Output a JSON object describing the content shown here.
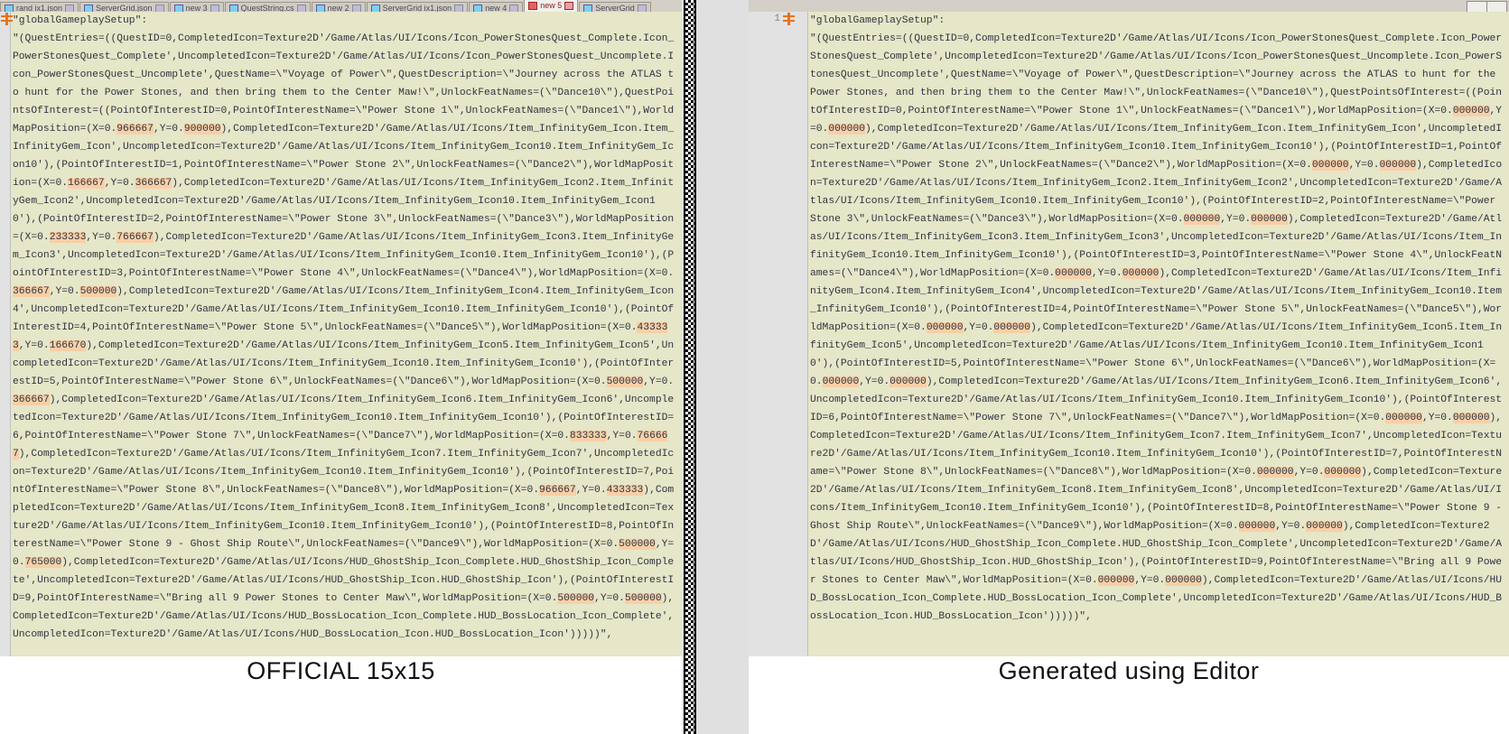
{
  "window": {
    "tabs": [
      {
        "label": "rand ix1.json",
        "active": false
      },
      {
        "label": "ServerGrid.json",
        "active": false
      },
      {
        "label": "new 3",
        "active": false
      },
      {
        "label": "QuestString.cs",
        "active": false
      },
      {
        "label": "new 2",
        "active": false
      },
      {
        "label": "ServerGrid ix1.json",
        "active": false
      },
      {
        "label": "new 4",
        "active": false
      },
      {
        "label": "new 5",
        "active": true
      },
      {
        "label": "ServerGrid",
        "active": false
      }
    ],
    "tab_controls": [
      "minimize-restore",
      "close"
    ]
  },
  "panes": {
    "left": {
      "caption": "OFFICIAL 15x15",
      "line_number": "",
      "fold_marker": "fold-marker-icon",
      "lines": [
        {
          "text": "\"globalGameplaySetup\":"
        },
        {
          "text": "\"(QuestEntries=((QuestID=0,CompletedIcon=Texture2D'/Game/Atlas/UI/Icons/Icon_PowerStonesQuest_Complete.Icon_PowerStonesQuest_Complete',UncompletedIcon=Texture2D'/Game/Atlas/UI/Icons/Icon_PowerStonesQuest_Uncomplete.Icon_PowerStonesQuest_Uncomplete',QuestName=\\\"Voyage of Power\\\",QuestDescription=\\\"Journey across the ATLAS to hunt for the Power Stones, and then bring them to the Center Maw!\\\",UnlockFeatNames=(\\\"Dance10\\\"),QuestPointsOfInterest=((PointOfInterestID=0,PointOfInterestName=\\\"Power Stone 1\\\",UnlockFeatNames=(\\\"Dance1\\\"),WorldMapPosition=(X=0."
        },
        {
          "hl": "966667"
        },
        {
          "text": ",Y=0."
        },
        {
          "hl": "900000"
        },
        {
          "text": "),CompletedIcon=Texture2D'/Game/Atlas/UI/Icons/Item_InfinityGem_Icon.Item_InfinityGem_Icon',UncompletedIcon=Texture2D'/Game/Atlas/UI/Icons/Item_InfinityGem_Icon10.Item_InfinityGem_Icon10'),(PointOfInterestID=1,PointOfInterestName=\\\"Power Stone 2\\\",UnlockFeatNames=(\\\"Dance2\\\"),WorldMapPosition=(X=0."
        },
        {
          "hl": "166667"
        },
        {
          "text": ",Y=0."
        },
        {
          "hl": "366667"
        },
        {
          "text": "),CompletedIcon=Texture2D'/Game/Atlas/UI/Icons/Item_InfinityGem_Icon2.Item_InfinityGem_Icon2',UncompletedIcon=Texture2D'/Game/Atlas/UI/Icons/Item_InfinityGem_Icon10.Item_InfinityGem_Icon10'),(PointOfInterestID=2,PointOfInterestName=\\\"Power Stone 3\\\",UnlockFeatNames=(\\\"Dance3\\\"),WorldMapPosition=(X=0."
        },
        {
          "hl": "233333"
        },
        {
          "text": ",Y=0."
        },
        {
          "hl": "766667"
        },
        {
          "text": "),CompletedIcon=Texture2D'/Game/Atlas/UI/Icons/Item_InfinityGem_Icon3.Item_InfinityGem_Icon3',UncompletedIcon=Texture2D'/Game/Atlas/UI/Icons/Item_InfinityGem_Icon10.Item_InfinityGem_Icon10'),(PointOfInterestID=3,PointOfInterestName=\\\"Power Stone 4\\\",UnlockFeatNames=(\\\"Dance4\\\"),WorldMapPosition=(X=0."
        },
        {
          "hl": "366667"
        },
        {
          "text": ",Y=0."
        },
        {
          "hl": "500000"
        },
        {
          "text": "),CompletedIcon=Texture2D'/Game/Atlas/UI/Icons/Item_InfinityGem_Icon4.Item_InfinityGem_Icon4',UncompletedIcon=Texture2D'/Game/Atlas/UI/Icons/Item_InfinityGem_Icon10.Item_InfinityGem_Icon10'),(PointOfInterestID=4,PointOfInterestName=\\\"Power Stone 5\\\",UnlockFeatNames=(\\\"Dance5\\\"),WorldMapPosition=(X=0."
        },
        {
          "hl": "433333"
        },
        {
          "text": ",Y=0."
        },
        {
          "hl": "166670"
        },
        {
          "text": "),CompletedIcon=Texture2D'/Game/Atlas/UI/Icons/Item_InfinityGem_Icon5.Item_InfinityGem_Icon5',UncompletedIcon=Texture2D'/Game/Atlas/UI/Icons/Item_InfinityGem_Icon10.Item_InfinityGem_Icon10'),(PointOfInterestID=5,PointOfInterestName=\\\"Power Stone 6\\\",UnlockFeatNames=(\\\"Dance6\\\"),WorldMapPosition=(X=0."
        },
        {
          "hl": "500000"
        },
        {
          "text": ",Y=0."
        },
        {
          "hl": "366667"
        },
        {
          "text": "),CompletedIcon=Texture2D'/Game/Atlas/UI/Icons/Item_InfinityGem_Icon6.Item_InfinityGem_Icon6',UncompletedIcon=Texture2D'/Game/Atlas/UI/Icons/Item_InfinityGem_Icon10.Item_InfinityGem_Icon10'),(PointOfInterestID=6,PointOfInterestName=\\\"Power Stone 7\\\",UnlockFeatNames=(\\\"Dance7\\\"),WorldMapPosition=(X=0."
        },
        {
          "hl": "833333"
        },
        {
          "text": ",Y=0."
        },
        {
          "hl": "766667"
        },
        {
          "text": "),CompletedIcon=Texture2D'/Game/Atlas/UI/Icons/Item_InfinityGem_Icon7.Item_InfinityGem_Icon7',UncompletedIcon=Texture2D'/Game/Atlas/UI/Icons/Item_InfinityGem_Icon10.Item_InfinityGem_Icon10'),(PointOfInterestID=7,PointOfInterestName=\\\"Power Stone 8\\\",UnlockFeatNames=(\\\"Dance8\\\"),WorldMapPosition=(X=0."
        },
        {
          "hl": "966667"
        },
        {
          "text": ",Y=0."
        },
        {
          "hl": "433333"
        },
        {
          "text": "),CompletedIcon=Texture2D'/Game/Atlas/UI/Icons/Item_InfinityGem_Icon8.Item_InfinityGem_Icon8',UncompletedIcon=Texture2D'/Game/Atlas/UI/Icons/Item_InfinityGem_Icon10.Item_InfinityGem_Icon10'),(PointOfInterestID=8,PointOfInterestName=\\\"Power Stone 9 - Ghost Ship Route\\\",UnlockFeatNames=(\\\"Dance9\\\"),WorldMapPosition=(X=0."
        },
        {
          "hl": "500000"
        },
        {
          "text": ",Y=0."
        },
        {
          "hl": "765000"
        },
        {
          "text": "),CompletedIcon=Texture2D'/Game/Atlas/UI/Icons/HUD_GhostShip_Icon_Complete.HUD_GhostShip_Icon_Complete',UncompletedIcon=Texture2D'/Game/Atlas/UI/Icons/HUD_GhostShip_Icon.HUD_GhostShip_Icon'),(PointOfInterestID=9,PointOfInterestName=\\\"Bring all 9 Power Stones to Center Maw\\\",WorldMapPosition=(X=0."
        },
        {
          "hl": "500000"
        },
        {
          "text": ",Y=0."
        },
        {
          "hl": "500000"
        },
        {
          "text": "),CompletedIcon=Texture2D'/Game/Atlas/UI/Icons/HUD_BossLocation_Icon_Complete.HUD_BossLocation_Icon_Complete',UncompletedIcon=Texture2D'/Game/Atlas/UI/Icons/HUD_BossLocation_Icon.HUD_BossLocation_Icon')))))\","
        }
      ]
    },
    "right": {
      "caption": "Generated using Editor",
      "line_number": "1",
      "fold_marker": "fold-marker-icon",
      "lines": [
        {
          "text": "\"globalGameplaySetup\":"
        },
        {
          "text": "\"(QuestEntries=((QuestID=0,CompletedIcon=Texture2D'/Game/Atlas/UI/Icons/Icon_PowerStonesQuest_Complete.Icon_PowerStonesQuest_Complete',UncompletedIcon=Texture2D'/Game/Atlas/UI/Icons/Icon_PowerStonesQuest_Uncomplete.Icon_PowerStonesQuest_Uncomplete',QuestName=\\\"Voyage of Power\\\",QuestDescription=\\\"Journey across the ATLAS to hunt for the Power Stones, and then bring them to the Center Maw!\\\",UnlockFeatNames=(\\\"Dance10\\\"),QuestPointsOfInterest=((PointOfInterestID=0,PointOfInterestName=\\\"Power Stone 1\\\",UnlockFeatNames=(\\\"Dance1\\\"),WorldMapPosition=(X=0."
        },
        {
          "hl": "000000"
        },
        {
          "text": ",Y=0."
        },
        {
          "hl": "000000"
        },
        {
          "text": "),CompletedIcon=Texture2D'/Game/Atlas/UI/Icons/Item_InfinityGem_Icon.Item_InfinityGem_Icon',UncompletedIcon=Texture2D'/Game/Atlas/UI/Icons/Item_InfinityGem_Icon10.Item_InfinityGem_Icon10'),(PointOfInterestID=1,PointOfInterestName=\\\"Power Stone 2\\\",UnlockFeatNames=(\\\"Dance2\\\"),WorldMapPosition=(X=0."
        },
        {
          "hl": "000000"
        },
        {
          "text": ",Y=0."
        },
        {
          "hl": "000000"
        },
        {
          "text": "),CompletedIcon=Texture2D'/Game/Atlas/UI/Icons/Item_InfinityGem_Icon2.Item_InfinityGem_Icon2',UncompletedIcon=Texture2D'/Game/Atlas/UI/Icons/Item_InfinityGem_Icon10.Item_InfinityGem_Icon10'),(PointOfInterestID=2,PointOfInterestName=\\\"Power Stone 3\\\",UnlockFeatNames=(\\\"Dance3\\\"),WorldMapPosition=(X=0."
        },
        {
          "hl": "000000"
        },
        {
          "text": ",Y=0."
        },
        {
          "hl": "000000"
        },
        {
          "text": "),CompletedIcon=Texture2D'/Game/Atlas/UI/Icons/Item_InfinityGem_Icon3.Item_InfinityGem_Icon3',UncompletedIcon=Texture2D'/Game/Atlas/UI/Icons/Item_InfinityGem_Icon10.Item_InfinityGem_Icon10'),(PointOfInterestID=3,PointOfInterestName=\\\"Power Stone 4\\\",UnlockFeatNames=(\\\"Dance4\\\"),WorldMapPosition=(X=0."
        },
        {
          "hl": "000000"
        },
        {
          "text": ",Y=0."
        },
        {
          "hl": "000000"
        },
        {
          "text": "),CompletedIcon=Texture2D'/Game/Atlas/UI/Icons/Item_InfinityGem_Icon4.Item_InfinityGem_Icon4',UncompletedIcon=Texture2D'/Game/Atlas/UI/Icons/Item_InfinityGem_Icon10.Item_InfinityGem_Icon10'),(PointOfInterestID=4,PointOfInterestName=\\\"Power Stone 5\\\",UnlockFeatNames=(\\\"Dance5\\\"),WorldMapPosition=(X=0."
        },
        {
          "hl": "000000"
        },
        {
          "text": ",Y=0."
        },
        {
          "hl": "000000"
        },
        {
          "text": "),CompletedIcon=Texture2D'/Game/Atlas/UI/Icons/Item_InfinityGem_Icon5.Item_InfinityGem_Icon5',UncompletedIcon=Texture2D'/Game/Atlas/UI/Icons/Item_InfinityGem_Icon10.Item_InfinityGem_Icon10'),(PointOfInterestID=5,PointOfInterestName=\\\"Power Stone 6\\\",UnlockFeatNames=(\\\"Dance6\\\"),WorldMapPosition=(X=0."
        },
        {
          "hl": "000000"
        },
        {
          "text": ",Y=0."
        },
        {
          "hl": "000000"
        },
        {
          "text": "),CompletedIcon=Texture2D'/Game/Atlas/UI/Icons/Item_InfinityGem_Icon6.Item_InfinityGem_Icon6',UncompletedIcon=Texture2D'/Game/Atlas/UI/Icons/Item_InfinityGem_Icon10.Item_InfinityGem_Icon10'),(PointOfInterestID=6,PointOfInterestName=\\\"Power Stone 7\\\",UnlockFeatNames=(\\\"Dance7\\\"),WorldMapPosition=(X=0."
        },
        {
          "hl": "000000"
        },
        {
          "text": ",Y=0."
        },
        {
          "hl": "000000"
        },
        {
          "text": "),CompletedIcon=Texture2D'/Game/Atlas/UI/Icons/Item_InfinityGem_Icon7.Item_InfinityGem_Icon7',UncompletedIcon=Texture2D'/Game/Atlas/UI/Icons/Item_InfinityGem_Icon10.Item_InfinityGem_Icon10'),(PointOfInterestID=7,PointOfInterestName=\\\"Power Stone 8\\\",UnlockFeatNames=(\\\"Dance8\\\"),WorldMapPosition=(X=0."
        },
        {
          "hl": "000000"
        },
        {
          "text": ",Y=0."
        },
        {
          "hl": "000000"
        },
        {
          "text": "),CompletedIcon=Texture2D'/Game/Atlas/UI/Icons/Item_InfinityGem_Icon8.Item_InfinityGem_Icon8',UncompletedIcon=Texture2D'/Game/Atlas/UI/Icons/Item_InfinityGem_Icon10.Item_InfinityGem_Icon10'),(PointOfInterestID=8,PointOfInterestName=\\\"Power Stone 9 - Ghost Ship Route\\\",UnlockFeatNames=(\\\"Dance9\\\"),WorldMapPosition=(X=0."
        },
        {
          "hl": "000000"
        },
        {
          "text": ",Y=0."
        },
        {
          "hl": "000000"
        },
        {
          "text": "),CompletedIcon=Texture2D'/Game/Atlas/UI/Icons/HUD_GhostShip_Icon_Complete.HUD_GhostShip_Icon_Complete',UncompletedIcon=Texture2D'/Game/Atlas/UI/Icons/HUD_GhostShip_Icon.HUD_GhostShip_Icon'),(PointOfInterestID=9,PointOfInterestName=\\\"Bring all 9 Power Stones to Center Maw\\\",WorldMapPosition=(X=0."
        },
        {
          "hl": "000000"
        },
        {
          "text": ",Y=0."
        },
        {
          "hl": "000000"
        },
        {
          "text": "),CompletedIcon=Texture2D'/Game/Atlas/UI/Icons/HUD_BossLocation_Icon_Complete.HUD_BossLocation_Icon_Complete',UncompletedIcon=Texture2D'/Game/Atlas/UI/Icons/HUD_BossLocation_Icon.HUD_BossLocation_Icon')))))\","
        }
      ]
    }
  },
  "colors": {
    "editor_background": "#e6e6c8",
    "highlight": "#f8cfa6",
    "text": "#2f3340",
    "gutter": "#e2e2e2",
    "tabbar": "#d4d0c8",
    "divider": "#e0e0e0"
  }
}
